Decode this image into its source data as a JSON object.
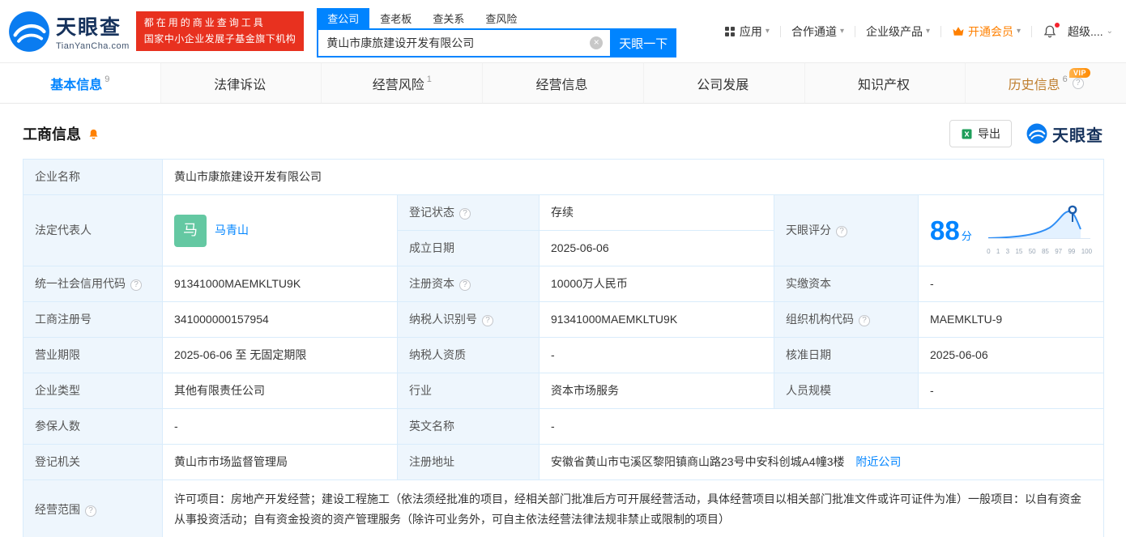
{
  "colors": {
    "accent_blue": "#0084ff",
    "brand_red": "#e8311f",
    "vip_orange": "#ff8000",
    "status_green": "#2bb24c",
    "history_gold": "#bf7e2e",
    "avatar_green": "#64c8a2",
    "label_cell_bg": "#eef6fd",
    "table_border": "#d9ecfb"
  },
  "icons": {
    "help": "?",
    "chevron_down": "▾",
    "chevron_expand": "⌄",
    "clear": "×",
    "vip_tag": "VIP"
  },
  "header": {
    "logo_brand": "天眼查",
    "logo_domain": "TianYanCha.com",
    "slogan_line1": "都在用的商业查询工具",
    "slogan_line2": "国家中小企业发展子基金旗下机构",
    "search_tabs": [
      {
        "label": "查公司"
      },
      {
        "label": "查老板"
      },
      {
        "label": "查关系"
      },
      {
        "label": "查风险"
      }
    ],
    "search_value": "黄山市康旅建设开发有限公司",
    "search_button": "天眼一下",
    "nav_app": "应用",
    "nav_cooperation": "合作通道",
    "nav_enterprise": "企业级产品",
    "nav_vip": "开通会员",
    "nav_super": "超级...."
  },
  "tabs": [
    {
      "label": "基本信息",
      "count": "9"
    },
    {
      "label": "法律诉讼",
      "count": ""
    },
    {
      "label": "经营风险",
      "count": "1"
    },
    {
      "label": "经营信息",
      "count": ""
    },
    {
      "label": "公司发展",
      "count": ""
    },
    {
      "label": "知识产权",
      "count": ""
    },
    {
      "label": "历史信息",
      "count": "6"
    }
  ],
  "section": {
    "title": "工商信息",
    "export_label": "导出",
    "corner_logo": "天眼查"
  },
  "fields": {
    "company_name": {
      "label": "企业名称",
      "value": "黄山市康旅建设开发有限公司"
    },
    "legal_rep": {
      "label": "法定代表人",
      "avatar_char": "马",
      "name": "马青山"
    },
    "reg_status": {
      "label": "登记状态",
      "value": "存续"
    },
    "establish_date": {
      "label": "成立日期",
      "value": "2025-06-06"
    },
    "tyc_score": {
      "label": "天眼评分"
    },
    "credit_code": {
      "label": "统一社会信用代码",
      "value": "91341000MAEMKLTU9K"
    },
    "reg_capital": {
      "label": "注册资本",
      "value": "10000万人民币"
    },
    "paid_capital": {
      "label": "实缴资本",
      "value": "-"
    },
    "reg_number": {
      "label": "工商注册号",
      "value": "341000000157954"
    },
    "taxpayer_id": {
      "label": "纳税人识别号",
      "value": "91341000MAEMKLTU9K"
    },
    "org_code": {
      "label": "组织机构代码",
      "value": "MAEMKLTU-9"
    },
    "business_term": {
      "label": "营业期限",
      "value": "2025-06-06 至 无固定期限"
    },
    "taxpayer_qualification": {
      "label": "纳税人资质",
      "value": "-"
    },
    "approval_date": {
      "label": "核准日期",
      "value": "2025-06-06"
    },
    "company_type": {
      "label": "企业类型",
      "value": "其他有限责任公司"
    },
    "industry": {
      "label": "行业",
      "value": "资本市场服务"
    },
    "staff_size": {
      "label": "人员规模",
      "value": "-"
    },
    "insured_count": {
      "label": "参保人数",
      "value": "-"
    },
    "english_name": {
      "label": "英文名称",
      "value": "-"
    },
    "registry_authority": {
      "label": "登记机关",
      "value": "黄山市市场监督管理局"
    },
    "reg_address": {
      "label": "注册地址",
      "value": "安徽省黄山市屯溪区黎阳镇商山路23号中安科创城A4幢3楼",
      "link": "附近公司"
    },
    "business_scope": {
      "label": "经营范围",
      "value": "许可项目：房地产开发经营；建设工程施工（依法须经批准的项目，经相关部门批准后方可开展经营活动，具体经营项目以相关部门批准文件或许可证件为准）一般项目：以自有资金从事投资活动；自有资金投资的资产管理服务（除许可业务外，可自主依法经营法律法规非禁止或限制的项目）"
    }
  },
  "score": {
    "value": "88",
    "unit": "分",
    "axis": [
      "0",
      "1",
      "3",
      "15",
      "50",
      "85",
      "97",
      "99",
      "100"
    ]
  }
}
